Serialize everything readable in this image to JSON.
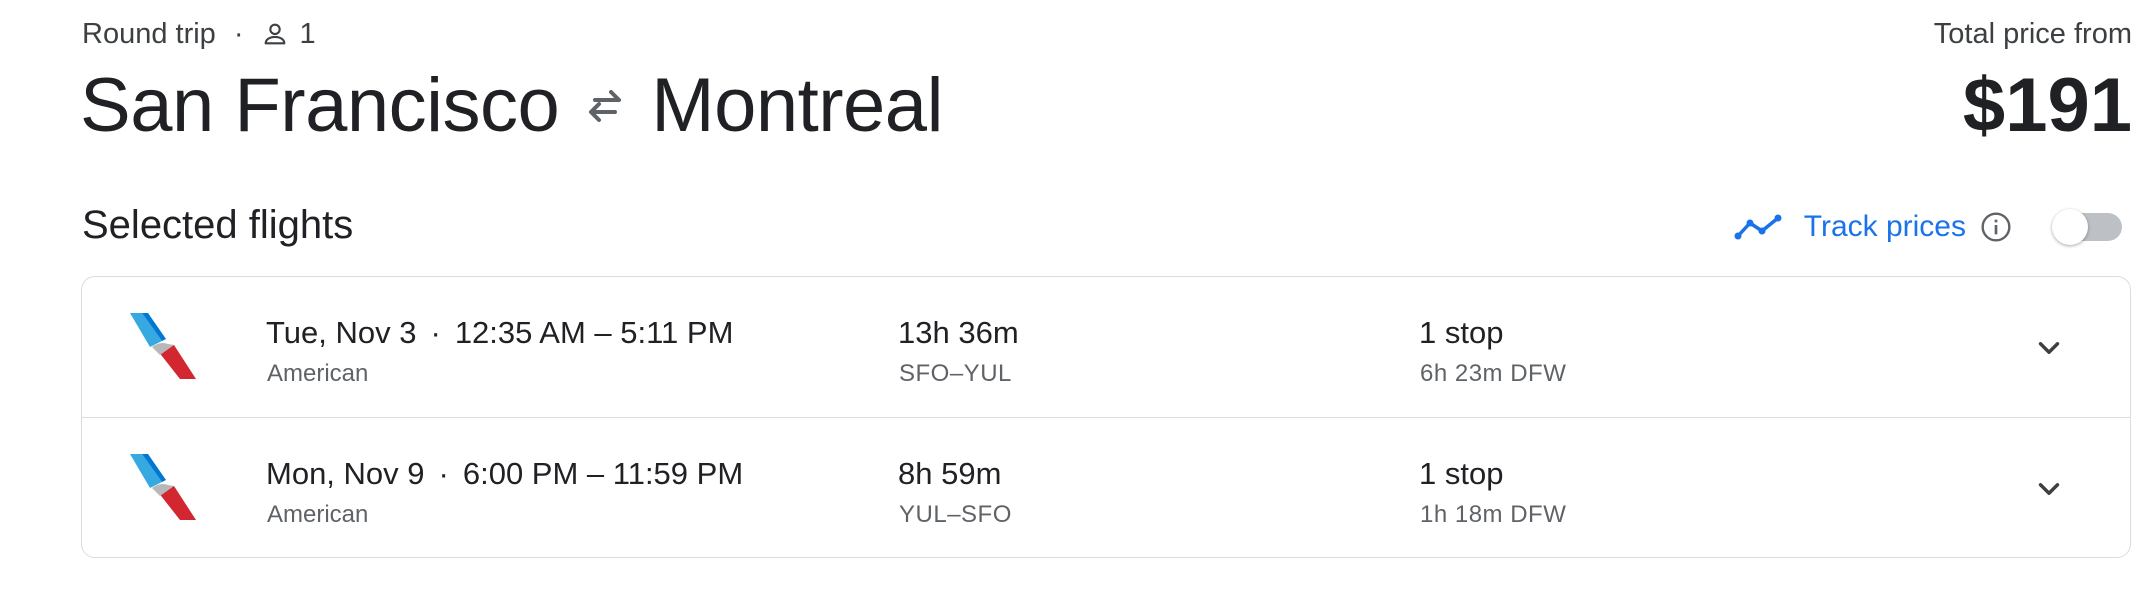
{
  "trip": {
    "type": "Round trip",
    "separator": "·",
    "passengers": "1",
    "person_icon": "person-outline-icon"
  },
  "route": {
    "origin": "San Francisco",
    "destination": "Montreal",
    "swap_icon": "swap-arrows-icon"
  },
  "price": {
    "label": "Total price from",
    "value": "$191"
  },
  "selected": {
    "title": "Selected flights"
  },
  "track": {
    "label": "Track prices",
    "enabled": false,
    "trend_icon": "trending-line-icon",
    "info_icon": "info-icon"
  },
  "flights": [
    {
      "date": "Tue, Nov 3",
      "separator": "·",
      "times": "12:35 AM – 5:11 PM",
      "airline": "American",
      "duration": "13h 36m",
      "airports": "SFO–YUL",
      "stops": "1 stop",
      "layover": "6h 23m DFW"
    },
    {
      "date": "Mon, Nov 9",
      "separator": "·",
      "times": "6:00 PM – 11:59 PM",
      "airline": "American",
      "duration": "8h 59m",
      "airports": "YUL–SFO",
      "stops": "1 stop",
      "layover": "1h 18m DFW"
    }
  ],
  "colors": {
    "accent": "#1a73e8",
    "text_primary": "#202124",
    "text_secondary": "#5f6368",
    "border": "#dadce0",
    "logo_blue": "#36a9e1",
    "logo_red": "#d22630"
  }
}
